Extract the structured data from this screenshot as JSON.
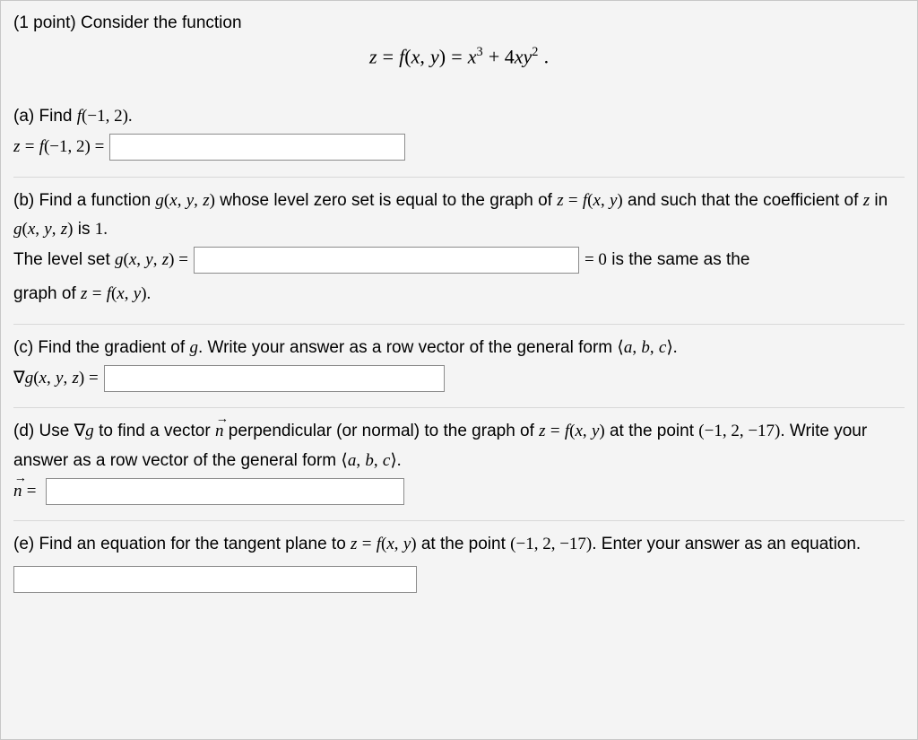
{
  "header": {
    "points_text": "(1 point) Consider the function"
  },
  "equation_center": {
    "html": "<span class='mi'>z</span> <span class='mn'>=</span> <span class='mi'>f</span><span class='mn'>(</span><span class='mi'>x</span><span class='mn'>,</span> <span class='mi'>y</span><span class='mn'>)</span> <span class='mn'>=</span> <span class='mi'>x</span><span class='sup mn'>3</span> <span class='mn'>+ 4</span><span class='mi'>x</span><span class='mi'>y</span><span class='sup mn'>2</span> <span class='mn'>.</span>"
  },
  "parts": {
    "a": {
      "prompt_prefix": "(a) Find ",
      "prompt_math": "<span class='mi'>f</span><span class='mn'>(−1, 2).</span>",
      "answer_prefix": "<span class='mi'>z</span> <span class='mn'>=</span> <span class='mi'>f</span><span class='mn'>(−1, 2) =</span>"
    },
    "b": {
      "prompt_line1_prefix": "(b) Find a function ",
      "prompt_line1_math1": "<span class='mi'>g</span><span class='mn'>(</span><span class='mi'>x</span><span class='mn'>,</span> <span class='mi'>y</span><span class='mn'>,</span> <span class='mi'>z</span><span class='mn'>)</span>",
      "prompt_line1_mid": " whose level zero set is equal to the graph of ",
      "prompt_line1_math2": "<span class='mi'>z</span> <span class='mn'>=</span> <span class='mi'>f</span><span class='mn'>(</span><span class='mi'>x</span><span class='mn'>,</span> <span class='mi'>y</span><span class='mn'>)</span>",
      "prompt_line1_tail": " and such that the coefficient of ",
      "prompt_line1_math3": "<span class='mi'>z</span>",
      "prompt_line1_tail2": " in ",
      "prompt_line1_math4": "<span class='mi'>g</span><span class='mn'>(</span><span class='mi'>x</span><span class='mn'>,</span> <span class='mi'>y</span><span class='mn'>,</span> <span class='mi'>z</span><span class='mn'>)</span>",
      "prompt_line1_tail3": " is ",
      "prompt_line1_math5": "<span class='mn'>1</span>",
      "answer_prefix": "The level set <span class='mi'>g</span><span class='mn'>(</span><span class='mi'>x</span><span class='mn'>,</span> <span class='mi'>y</span><span class='mn'>,</span> <span class='mi'>z</span><span class='mn'>) =</span>",
      "answer_after": "<span class='mn'>= 0</span> is the same as the",
      "answer_line2": "graph of <span class='mi'>z</span> <span class='mn'>=</span> <span class='mi'>f</span><span class='mn'>(</span><span class='mi'>x</span><span class='mn'>,</span> <span class='mi'>y</span><span class='mn'>).</span>"
    },
    "c": {
      "prompt": "(c) Find the gradient of <span class='mi'>g</span>. Write your answer as a row vector of the general form <span class='angle-l'></span><span class='mi'>a</span><span class='mn'>,</span> <span class='mi'>b</span><span class='mn'>,</span> <span class='mi'>c</span><span class='angle-r'></span><span class='mn'>.</span>",
      "answer_prefix": "<span class='mn'>∇</span><span class='mi'>g</span><span class='mn'>(</span><span class='mi'>x</span><span class='mn'>,</span> <span class='mi'>y</span><span class='mn'>,</span> <span class='mi'>z</span><span class='mn'>) =</span>"
    },
    "d": {
      "prompt": "(d) Use <span class='mn'>∇</span><span class='mi'>g</span> to find a vector <span class='mi vecarrow'>n</span> perpendicular (or normal) to the graph of <span class='mi'>z</span> <span class='mn'>=</span> <span class='mi'>f</span><span class='mn'>(</span><span class='mi'>x</span><span class='mn'>,</span> <span class='mi'>y</span><span class='mn'>)</span> at the point <span class='mn'>(−1, 2, −17)</span>. Write your answer as a row vector of the general form <span class='angle-l'></span><span class='mi'>a</span><span class='mn'>,</span> <span class='mi'>b</span><span class='mn'>,</span> <span class='mi'>c</span><span class='angle-r'></span><span class='mn'>.</span>",
      "answer_prefix": "<span class='mi vecarrow'>n</span> <span class='mn'>=</span>"
    },
    "e": {
      "prompt": "(e) Find an equation for the tangent plane to <span class='mi'>z</span> <span class='mn'>=</span> <span class='mi'>f</span><span class='mn'>(</span><span class='mi'>x</span><span class='mn'>,</span> <span class='mi'>y</span><span class='mn'>)</span> at the point <span class='mn'>(−1, 2, −17)</span>. Enter your answer as an equation."
    }
  }
}
